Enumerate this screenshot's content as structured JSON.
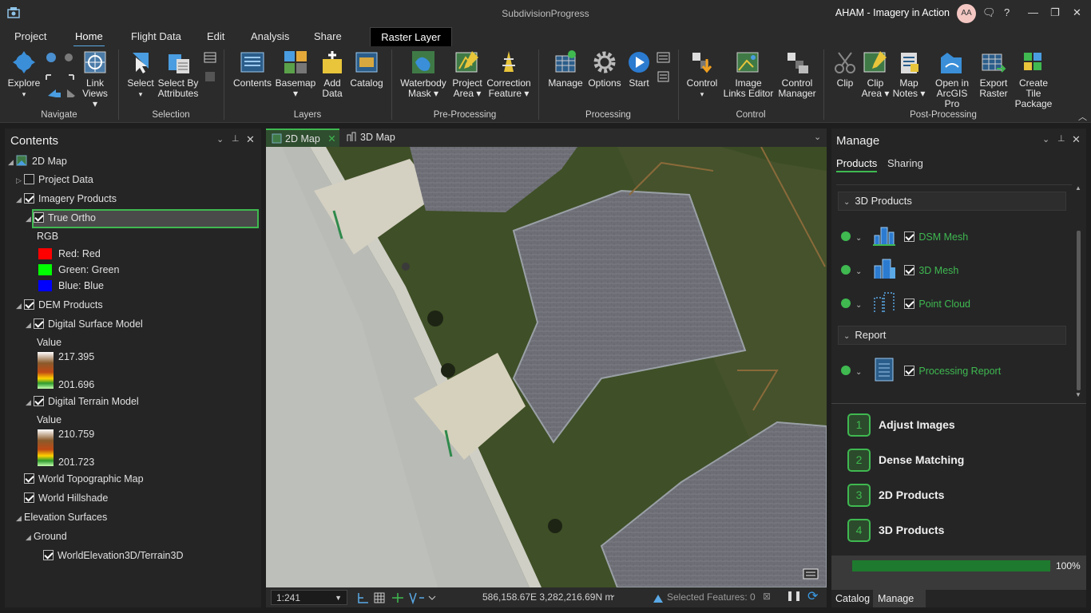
{
  "app": {
    "title": "SubdivisionProgress",
    "user": "AHAM - Imagery in Action",
    "initials": "AA"
  },
  "menu": {
    "tabs": [
      "Project",
      "Home",
      "Flight Data",
      "Edit",
      "Analysis",
      "Share"
    ],
    "active": "Home",
    "contextual_tab": "Raster Layer"
  },
  "ribbon": {
    "groups": {
      "navigate": "Navigate",
      "selection": "Selection",
      "layers": "Layers",
      "preprocessing": "Pre-Processing",
      "processing": "Processing",
      "control": "Control",
      "postprocessing": "Post-Processing"
    },
    "explore": "Explore",
    "link_views": "Link Views",
    "select": "Select",
    "select_by_attributes": "Select By Attributes",
    "contents": "Contents",
    "basemap": "Basemap",
    "add_data": "Add Data",
    "catalog": "Catalog",
    "waterbody_mask": "Waterbody Mask",
    "project_area": "Project Area",
    "correction_feature": "Correction Feature",
    "manage": "Manage",
    "options": "Options",
    "start": "Start",
    "control": "Control",
    "image_links_editor": "Image Links Editor",
    "control_manager": "Control Manager",
    "clip": "Clip",
    "clip_area": "Clip Area",
    "map_notes": "Map Notes",
    "open_in_arcgis_pro": "Open in ArcGIS Pro",
    "export_raster": "Export Raster",
    "create_tile_package": "Create Tile Package"
  },
  "contents": {
    "title": "Contents",
    "map": "2D Map",
    "project_data": "Project Data",
    "imagery_products": "Imagery Products",
    "true_ortho": "True Ortho",
    "rgb": "RGB",
    "red": "Red:  Red",
    "green": "Green: Green",
    "blue": "Blue:  Blue",
    "dem_products": "DEM Products",
    "dsm": "Digital Surface Model",
    "dsm_value_label": "Value",
    "dsm_high": "217.395",
    "dsm_low": "201.696",
    "dtm": "Digital Terrain Model",
    "dtm_value_label": "Value",
    "dtm_high": "210.759",
    "dtm_low": "201.723",
    "world_topo": "World Topographic Map",
    "world_hillshade": "World Hillshade",
    "elevation_surfaces": "Elevation Surfaces",
    "ground": "Ground",
    "world_elevation": "WorldElevation3D/Terrain3D",
    "colors": {
      "red": "#ff0000",
      "green": "#00ff00",
      "blue": "#0000ff"
    }
  },
  "map": {
    "tabs": [
      "2D Map",
      "3D Map"
    ],
    "scale": "1:241",
    "coordinates": "586,158.67E 3,282,216.69N m",
    "selected_features": "Selected Features: 0"
  },
  "manage": {
    "title": "Manage",
    "tabs": [
      "Products",
      "Sharing"
    ],
    "section_3d": "3D Products",
    "dsm_mesh": "DSM Mesh",
    "mesh_3d": "3D Mesh",
    "point_cloud": "Point Cloud",
    "section_report": "Report",
    "processing_report": "Processing Report",
    "steps": [
      {
        "num": "1",
        "label": "Adjust Images"
      },
      {
        "num": "2",
        "label": "Dense Matching"
      },
      {
        "num": "3",
        "label": "2D Products"
      },
      {
        "num": "4",
        "label": "3D Products"
      }
    ],
    "progress": 1.0,
    "progress_label": "100%",
    "bottom_tabs": [
      "Catalog",
      "Manage"
    ]
  },
  "accent": "#3fb950"
}
